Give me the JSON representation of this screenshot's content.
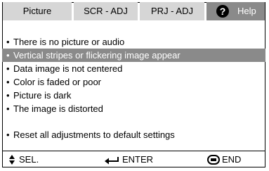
{
  "tabs": [
    {
      "label": "Picture"
    },
    {
      "label": "SCR - ADJ"
    },
    {
      "label": "PRJ - ADJ"
    }
  ],
  "help": {
    "icon": "?",
    "label": "Help"
  },
  "menu": {
    "items": [
      {
        "label": "There is no picture or audio",
        "selected": false
      },
      {
        "label": "Vertical stripes or flickering image appear",
        "selected": true
      },
      {
        "label": "Data image is not centered",
        "selected": false
      },
      {
        "label": "Color is faded or poor",
        "selected": false
      },
      {
        "label": "Picture is dark",
        "selected": false
      },
      {
        "label": "The image is distorted",
        "selected": false
      }
    ],
    "reset": {
      "label": "Reset all adjustments to default settings"
    }
  },
  "footer": {
    "sel": {
      "icon": "up-down-arrows-icon",
      "label": "SEL."
    },
    "enter": {
      "icon": "enter-arrow-icon",
      "label": "ENTER"
    },
    "end": {
      "icon": "end-button-icon",
      "label": "END"
    }
  },
  "colors": {
    "tab_bg": "#d6d6d6",
    "selected_bg": "#8a8a8a",
    "selected_text": "#ffffff"
  }
}
